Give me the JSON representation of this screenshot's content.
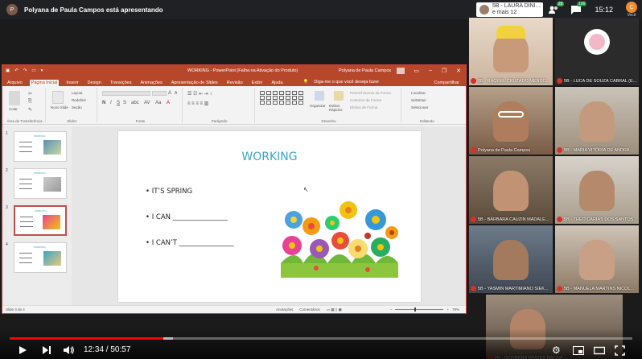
{
  "top": {
    "presenting_text": "Polyana de Paula Campos está apresentando",
    "user_name_line1": "5B - LAURA DINI...",
    "user_name_line2": "e mais 12",
    "participants_count": "29",
    "chat_badge": "100",
    "clock": "15:12",
    "me_label": "Você",
    "me_initial": "C"
  },
  "ppt": {
    "doc_title": "WORKING  -  PowerPoint (Falha na Ativação do Produto)",
    "user": "Polyana de Paula Campos",
    "tabs": [
      "Arquivo",
      "Página Inicial",
      "Inserir",
      "Design",
      "Transições",
      "Animações",
      "Apresentação de Slides",
      "Revisão",
      "Exibir",
      "Ajuda"
    ],
    "active_tab": "Página Inicial",
    "tell_me": "Diga-me o que você deseja fazer",
    "share": "Compartilhar",
    "ribbon": {
      "paste": "Colar",
      "clipboard_group": "Área de Transferência",
      "new_slide": "Novo Slide",
      "layout": "Layout",
      "reset": "Redefinir",
      "section": "Seção",
      "slides_group": "Slides",
      "font_group": "Fonte",
      "paragraph_group": "Parágrafo",
      "arrange": "Organizar",
      "quick_styles": "Estilos Rápidos",
      "shape_fill": "Preenchimento da Forma",
      "shape_outline": "Contorno da Forma",
      "shape_effects": "Efeitos de Forma",
      "drawing_group": "Desenho",
      "find": "Localizar",
      "replace": "Substituir",
      "select": "Selecionar",
      "editing_group": "Editando"
    },
    "slide_numbers": [
      "1",
      "2",
      "3",
      "4"
    ],
    "selected_slide": 3,
    "thumb_title": "WORKING",
    "slide": {
      "title": "WORKING",
      "bullets": [
        "• IT’S SPRING",
        "• I CAN ________________",
        "• I CAN’T ________________"
      ]
    },
    "status": {
      "slide_of": "Slide 3 de 4",
      "notes": "Anotações",
      "comments": "Comentários",
      "zoom": "79%"
    }
  },
  "participants": [
    {
      "name": "5B - RAQUEL CRUZADO MENDO..."
    },
    {
      "name": "5B - LUCA DE SOUZA CABRAL (E..."
    },
    {
      "name": "Polyana de Paula Campos"
    },
    {
      "name": "5B - MARIA VITÓRIA DE ANDRA..."
    },
    {
      "name": "5B - BÁRBARA CAUZIN MADALE..."
    },
    {
      "name": "5B - THÉO CARIAS DOS SANTOS..."
    },
    {
      "name": "5B - YASMIN MARTIMIANO SIEK..."
    },
    {
      "name": "5B - MANUELA MARTINS NICOL..."
    },
    {
      "name": "5B - GIOVANNA PRATES MACHA..."
    }
  ],
  "player": {
    "time": "12:34 / 50:57",
    "progress": 0.247,
    "buffered": 0.262
  },
  "colors": {
    "ppt_accent": "#b7472a",
    "title_blue": "#3aa6c8",
    "progress_red": "#ff0000",
    "mic_red": "#d93025"
  }
}
